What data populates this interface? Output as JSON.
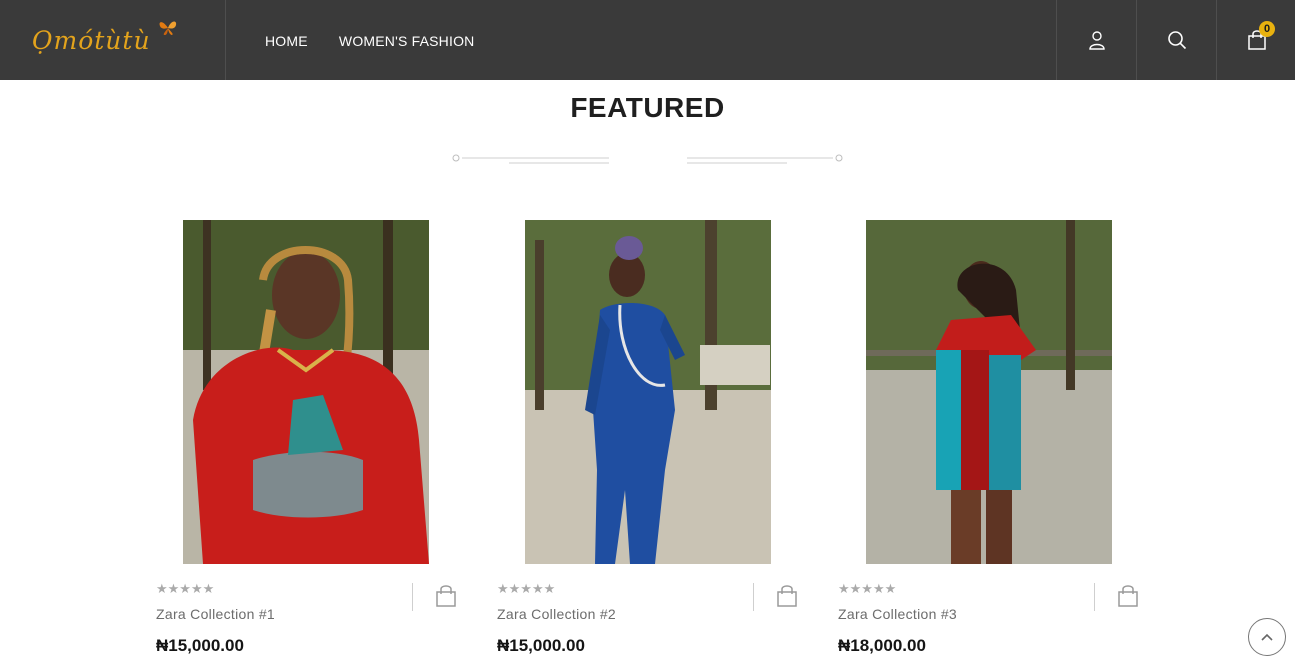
{
  "brand": {
    "logo_text": "Ọmótùtù"
  },
  "nav": {
    "items": [
      "HOME",
      "WOMEN'S FASHION"
    ]
  },
  "header": {
    "cart_count": "0"
  },
  "section": {
    "title": "FEATURED"
  },
  "products": [
    {
      "name": "Zara Collection #1",
      "price": "₦15,000.00",
      "rating": 0
    },
    {
      "name": "Zara Collection #2",
      "price": "₦15,000.00",
      "rating": 0
    },
    {
      "name": "Zara Collection #3",
      "price": "₦18,000.00",
      "rating": 0
    }
  ],
  "stars_glyph": "★★★★★",
  "colors": {
    "header_bg": "#3a3a3a",
    "logo": "#e3a31c",
    "badge": "#e8b10f"
  }
}
